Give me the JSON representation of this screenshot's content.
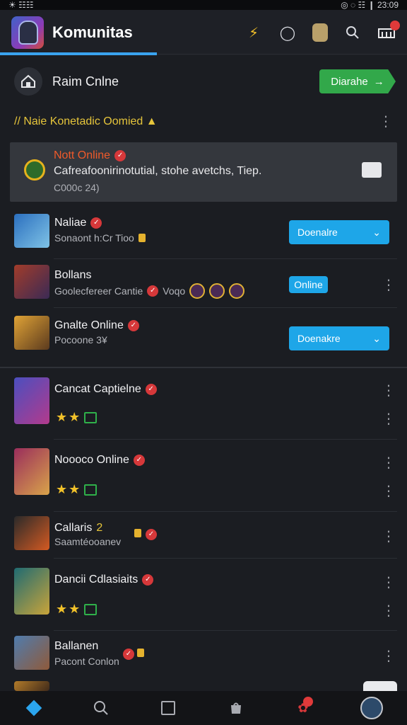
{
  "status_bar": {
    "left": "☀ ☷☷",
    "right": "◎ ◌ ☷ ❙ 23:09"
  },
  "app_bar": {
    "title": "Komunitas"
  },
  "home": {
    "label": "Raim Cnlne",
    "button_label": "Diarahe",
    "button_arrow": "→"
  },
  "section": {
    "title": "// Naie Konetadic Oomied ▲"
  },
  "highlight": {
    "title": "Nott Online",
    "body": "Cafreafoonirinotutial, stohe avetchs, Tiep.",
    "sub": "C000c 24)"
  },
  "rows": [
    {
      "title": "Naliae",
      "sub": "Sonaont h:Cr Tioo",
      "button": "Doenalre"
    },
    {
      "title": "Bollans",
      "sub": "Goolecfereer Cantie",
      "sub2": "Voqo",
      "tag": "Online"
    },
    {
      "title": "Gnalte Online",
      "sub": "Pocoone 3¥",
      "button": "Doenakre"
    },
    {
      "title": "Cancat Captielne",
      "sub": ""
    },
    {
      "title": "Noooco Online",
      "sub": ""
    },
    {
      "title": "Callaris",
      "title_suffix": "2",
      "sub": "Saamtéooanev"
    },
    {
      "title": "Dancii Cdlasiaits",
      "sub": ""
    },
    {
      "title": "Ballanen",
      "sub": "Pacont Conlon"
    }
  ],
  "colors": {
    "accent_blue": "#1ea6e8",
    "accent_green": "#32a84a",
    "accent_yellow": "#e6c53b",
    "alert_orange": "#f05a2a",
    "badge_red": "#d6383a"
  }
}
